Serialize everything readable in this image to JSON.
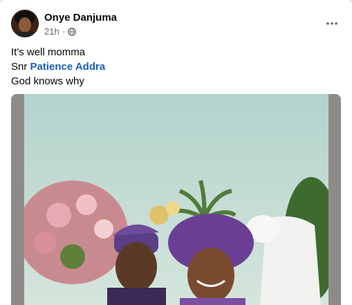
{
  "post": {
    "author": "Onye Danjuma",
    "time": "21h",
    "separator": "·",
    "privacy_icon": "globe-icon",
    "menu_icon": "more-horizontal-icon",
    "lines": {
      "line1": "It's well momma",
      "line2_prefix": "Snr",
      "line2_mention": "Patience Addra",
      "line3": "God knows why"
    },
    "photo": {
      "description_icon": "wedding-couple-photo"
    }
  },
  "colors": {
    "mention": "#1a5fb4",
    "meta": "#65676b",
    "photo_frame": "#8f8a8a"
  }
}
